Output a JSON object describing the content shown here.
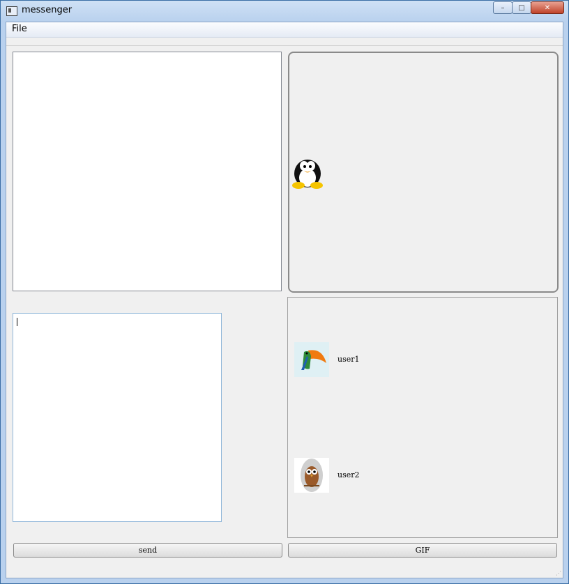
{
  "window": {
    "title": "messenger",
    "minimize_glyph": "–",
    "maximize_glyph": "□",
    "close_glyph": "✕"
  },
  "menu": {
    "file": "File"
  },
  "users": [
    {
      "name": "user1",
      "avatar": "toucan-icon"
    },
    {
      "name": "user2",
      "avatar": "owl-icon"
    }
  ],
  "buttons": {
    "send": "send",
    "gif": "GIF"
  },
  "colors": {
    "accent": "#3a6ea5",
    "panel_bg": "#f0f0f0",
    "input_border": "#8fb6d9"
  }
}
